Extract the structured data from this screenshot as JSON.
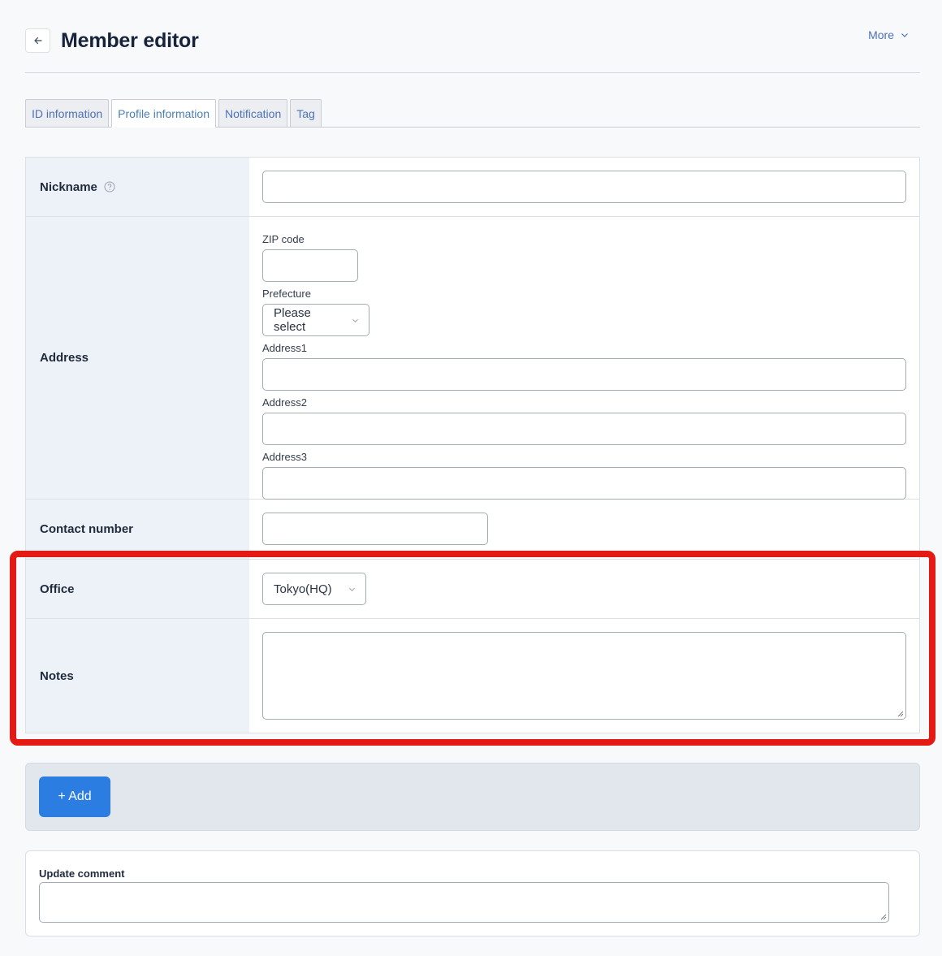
{
  "header": {
    "title": "Member editor",
    "back_icon": "arrow-left-icon",
    "more_label": "More",
    "more_icon": "chevron-down-icon"
  },
  "tabs": [
    {
      "label": "ID information",
      "active": false
    },
    {
      "label": "Profile information",
      "active": true
    },
    {
      "label": "Notification",
      "active": false
    },
    {
      "label": "Tag",
      "active": false
    }
  ],
  "form": {
    "nickname": {
      "label": "Nickname",
      "help_icon": "question-circle-icon",
      "value": ""
    },
    "address": {
      "label": "Address",
      "zip": {
        "label": "ZIP code",
        "value": ""
      },
      "prefecture": {
        "label": "Prefecture",
        "selected": "Please select"
      },
      "address1": {
        "label": "Address1",
        "value": ""
      },
      "address2": {
        "label": "Address2",
        "value": ""
      },
      "address3": {
        "label": "Address3",
        "value": ""
      }
    },
    "contact": {
      "label": "Contact number",
      "value": ""
    },
    "office": {
      "label": "Office",
      "selected": "Tokyo(HQ)"
    },
    "notes": {
      "label": "Notes",
      "value": ""
    }
  },
  "actions": {
    "add_label": "+ Add",
    "add_color": "#2b7de2"
  },
  "comment": {
    "label": "Update comment",
    "value": ""
  },
  "highlight_color": "#e31b14"
}
